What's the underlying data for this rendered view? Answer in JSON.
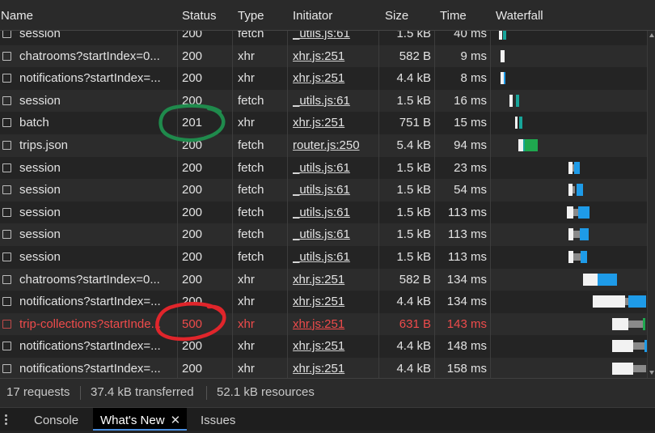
{
  "columns": {
    "name": "Name",
    "status": "Status",
    "type": "Type",
    "initiator": "Initiator",
    "size": "Size",
    "time": "Time",
    "waterfall": "Waterfall"
  },
  "rows": [
    {
      "name": "session",
      "status": "200",
      "type": "fetch",
      "initiator": "_utils.js:61",
      "size": "1.5 kB",
      "time": "40 ms",
      "error": false
    },
    {
      "name": "chatrooms?startIndex=0...",
      "status": "200",
      "type": "xhr",
      "initiator": "xhr.js:251",
      "size": "582 B",
      "time": "9 ms",
      "error": false
    },
    {
      "name": "notifications?startIndex=...",
      "status": "200",
      "type": "xhr",
      "initiator": "xhr.js:251",
      "size": "4.4 kB",
      "time": "8 ms",
      "error": false
    },
    {
      "name": "session",
      "status": "200",
      "type": "fetch",
      "initiator": "_utils.js:61",
      "size": "1.5 kB",
      "time": "16 ms",
      "error": false
    },
    {
      "name": "batch",
      "status": "201",
      "type": "xhr",
      "initiator": "xhr.js:251",
      "size": "751 B",
      "time": "15 ms",
      "error": false
    },
    {
      "name": "trips.json",
      "status": "200",
      "type": "fetch",
      "initiator": "router.js:250",
      "size": "5.4 kB",
      "time": "94 ms",
      "error": false
    },
    {
      "name": "session",
      "status": "200",
      "type": "fetch",
      "initiator": "_utils.js:61",
      "size": "1.5 kB",
      "time": "23 ms",
      "error": false
    },
    {
      "name": "session",
      "status": "200",
      "type": "fetch",
      "initiator": "_utils.js:61",
      "size": "1.5 kB",
      "time": "54 ms",
      "error": false
    },
    {
      "name": "session",
      "status": "200",
      "type": "fetch",
      "initiator": "_utils.js:61",
      "size": "1.5 kB",
      "time": "113 ms",
      "error": false
    },
    {
      "name": "session",
      "status": "200",
      "type": "fetch",
      "initiator": "_utils.js:61",
      "size": "1.5 kB",
      "time": "113 ms",
      "error": false
    },
    {
      "name": "session",
      "status": "200",
      "type": "fetch",
      "initiator": "_utils.js:61",
      "size": "1.5 kB",
      "time": "113 ms",
      "error": false
    },
    {
      "name": "chatrooms?startIndex=0...",
      "status": "200",
      "type": "xhr",
      "initiator": "xhr.js:251",
      "size": "582 B",
      "time": "134 ms",
      "error": false
    },
    {
      "name": "notifications?startIndex=...",
      "status": "200",
      "type": "xhr",
      "initiator": "xhr.js:251",
      "size": "4.4 kB",
      "time": "134 ms",
      "error": false
    },
    {
      "name": "trip-collections?startInde...",
      "status": "500",
      "type": "xhr",
      "initiator": "xhr.js:251",
      "size": "631 B",
      "time": "143 ms",
      "error": true
    },
    {
      "name": "notifications?startIndex=...",
      "status": "200",
      "type": "xhr",
      "initiator": "xhr.js:251",
      "size": "4.4 kB",
      "time": "148 ms",
      "error": false
    },
    {
      "name": "notifications?startIndex=...",
      "status": "200",
      "type": "xhr",
      "initiator": "xhr.js:251",
      "size": "4.4 kB",
      "time": "158 ms",
      "error": false
    }
  ],
  "summary": {
    "requests": "17 requests",
    "transferred": "37.4 kB transferred",
    "resources": "52.1 kB resources"
  },
  "drawer_tabs": {
    "console": "Console",
    "whats_new": "What's New",
    "issues": "Issues"
  },
  "colors": {
    "error_text": "#ef4b4b",
    "annotation_green": "#1f8a4c",
    "annotation_red": "#e0252b",
    "waterfall_blue": "#1e9be8",
    "waterfall_green": "#1fa84f"
  }
}
